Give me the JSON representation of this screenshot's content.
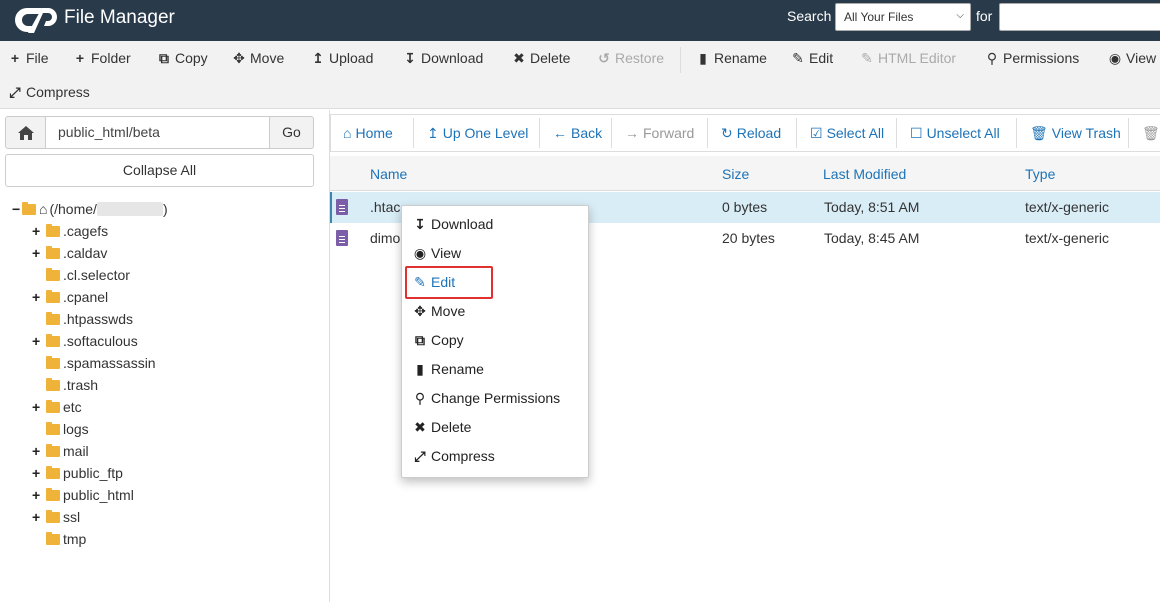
{
  "header": {
    "app_title": "File Manager",
    "search_label": "Search",
    "search_scope": "All Your Files",
    "for_label": "for",
    "search_value": ""
  },
  "toolbar": {
    "file": "File",
    "folder": "Folder",
    "copy": "Copy",
    "move": "Move",
    "upload": "Upload",
    "download": "Download",
    "delete": "Delete",
    "restore": "Restore",
    "rename": "Rename",
    "edit": "Edit",
    "html_editor": "HTML Editor",
    "permissions": "Permissions",
    "view": "View",
    "compress": "Compress"
  },
  "sidebar": {
    "path": "public_html/beta",
    "go": "Go",
    "collapse_all": "Collapse All",
    "root_label": "(/home/",
    "root_suffix": ")",
    "items": [
      {
        "label": ".cagefs",
        "expandable": true
      },
      {
        "label": ".caldav",
        "expandable": true
      },
      {
        "label": ".cl.selector",
        "expandable": false
      },
      {
        "label": ".cpanel",
        "expandable": true
      },
      {
        "label": ".htpasswds",
        "expandable": false
      },
      {
        "label": ".softaculous",
        "expandable": true
      },
      {
        "label": ".spamassassin",
        "expandable": false
      },
      {
        "label": ".trash",
        "expandable": false
      },
      {
        "label": "etc",
        "expandable": true
      },
      {
        "label": "logs",
        "expandable": false
      },
      {
        "label": "mail",
        "expandable": true
      },
      {
        "label": "public_ftp",
        "expandable": true
      },
      {
        "label": "public_html",
        "expandable": true
      },
      {
        "label": "ssl",
        "expandable": true
      },
      {
        "label": "tmp",
        "expandable": false
      }
    ]
  },
  "nav": {
    "home": "Home",
    "up_one_level": "Up One Level",
    "back": "Back",
    "forward": "Forward",
    "reload": "Reload",
    "select_all": "Select All",
    "unselect_all": "Unselect All",
    "view_trash": "View Trash"
  },
  "table": {
    "columns": {
      "name": "Name",
      "size": "Size",
      "modified": "Last Modified",
      "type": "Type"
    },
    "rows": [
      {
        "name": ".htac",
        "size": "0 bytes",
        "modified": "Today, 8:51 AM",
        "type": "text/x-generic"
      },
      {
        "name": "dimo",
        "size": "20 bytes",
        "modified": "Today, 8:45 AM",
        "type": "text/x-generic"
      }
    ]
  },
  "context_menu": {
    "download": "Download",
    "view": "View",
    "edit": "Edit",
    "move": "Move",
    "copy": "Copy",
    "rename": "Rename",
    "change_permissions": "Change Permissions",
    "delete": "Delete",
    "compress": "Compress"
  },
  "colors": {
    "header_bg": "#293a4a",
    "link_blue": "#1d73b8",
    "selected_row": "#d9edf7",
    "highlight_red": "#e03030",
    "folder_yellow": "#f0b33a",
    "file_icon": "#7b5ea7"
  }
}
